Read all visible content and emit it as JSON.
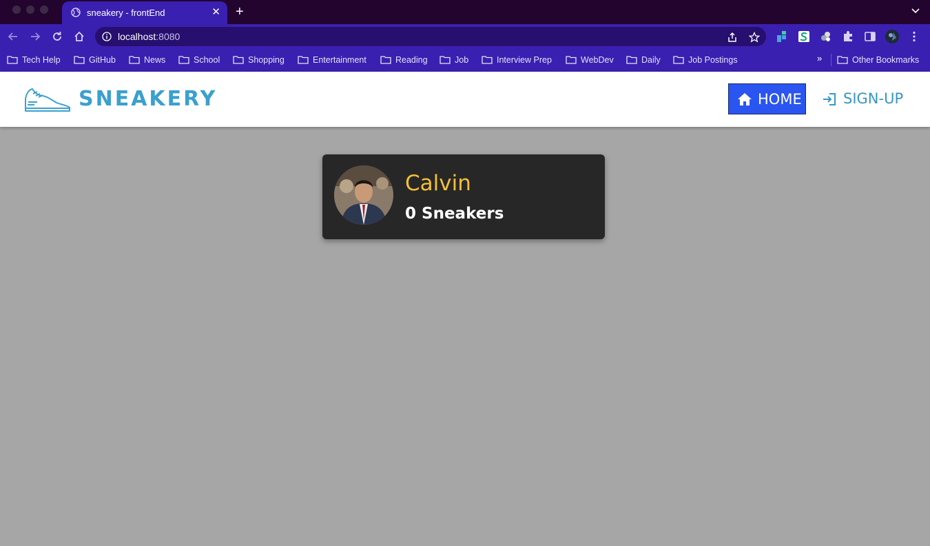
{
  "browser": {
    "tab_title": "sneakery - frontEnd",
    "tab_close": "✕",
    "new_tab": "+",
    "url_host": "localhost",
    "url_port": ":8080",
    "bookmarks": [
      "Tech Help",
      "GitHub",
      "News",
      "School",
      "Shopping",
      "Entertainment",
      "Reading",
      "Job",
      "Interview Prep",
      "WebDev",
      "Daily",
      "Job Postings"
    ],
    "bookmarks_more": "»",
    "other_bookmarks": "Other Bookmarks",
    "accent": "#3a20b0"
  },
  "app": {
    "logo_text": "SNEAKERY",
    "nav": {
      "home": "HOME",
      "signup": "SIGN-UP"
    },
    "brand_color": "#3aa0cf",
    "home_color": "#2a55f0"
  },
  "profile": {
    "name": "Calvin",
    "sneaker_count": "0 Sneakers",
    "name_color": "#f2c037"
  }
}
